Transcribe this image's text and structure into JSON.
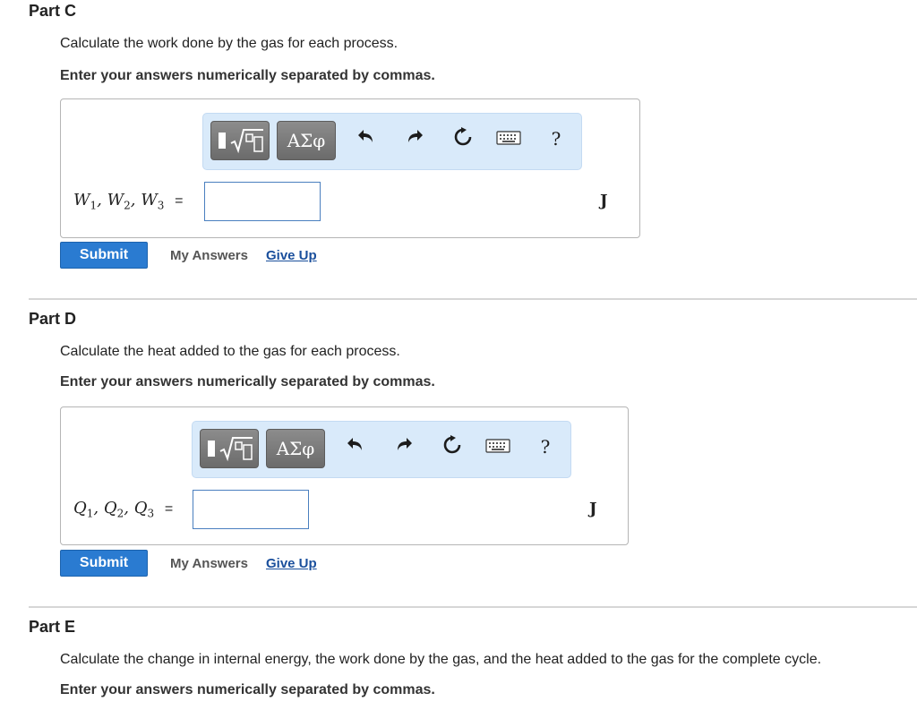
{
  "icons": [
    "template-icon",
    "greek-icon",
    "undo-icon",
    "redo-icon",
    "reset-icon",
    "keyboard-icon",
    "help-icon"
  ],
  "colors": {
    "submit": "#2a7bd1",
    "toolbar_bg": "#d9eafa",
    "link": "#1a4f9c"
  },
  "parts": [
    {
      "title": "Part C",
      "prompt": "Calculate the work done by the gas for each process.",
      "instruction": "Enter your answers numerically separated by commas.",
      "variable": {
        "symbol": "W",
        "subs": [
          "1",
          "2",
          "3"
        ],
        "equals": "="
      },
      "input_value": "",
      "unit": "J",
      "toolbar": {
        "greek": "ΑΣφ",
        "help": "?"
      },
      "submit_label": "Submit",
      "my_answers_label": "My Answers",
      "give_up_label": "Give Up"
    },
    {
      "title": "Part D",
      "prompt": "Calculate the heat added to the gas for each process.",
      "instruction": "Enter your answers numerically separated by commas.",
      "variable": {
        "symbol": "Q",
        "subs": [
          "1",
          "2",
          "3"
        ],
        "equals": "="
      },
      "input_value": "",
      "unit": "J",
      "toolbar": {
        "greek": "ΑΣφ",
        "help": "?"
      },
      "submit_label": "Submit",
      "my_answers_label": "My Answers",
      "give_up_label": "Give Up"
    },
    {
      "title": "Part E",
      "prompt": "Calculate the change in internal energy, the work done by the gas, and the heat added to the gas for the complete cycle.",
      "instruction": "Enter your answers numerically separated by commas."
    }
  ]
}
